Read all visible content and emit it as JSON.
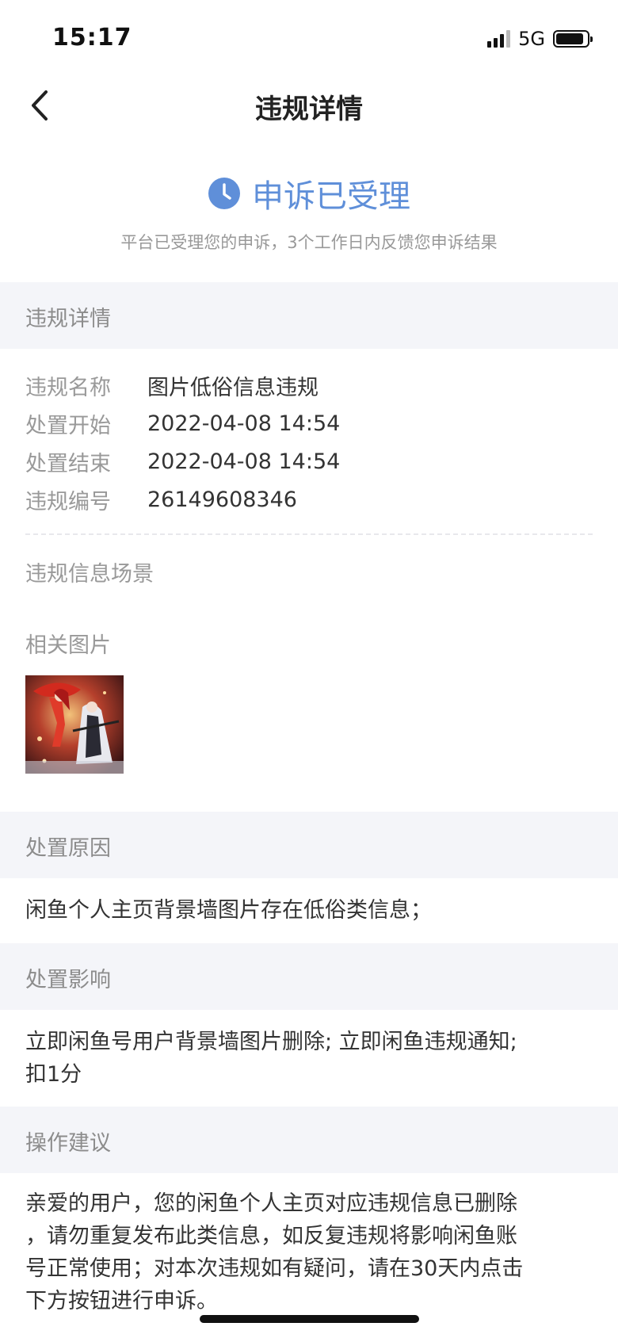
{
  "status_bar": {
    "time": "15:17",
    "network": "5G",
    "signal_icon": "signal-bars-icon",
    "battery_icon": "battery-icon"
  },
  "nav": {
    "title": "违规详情",
    "back_icon": "chevron-left-icon"
  },
  "appeal": {
    "icon": "clock-icon",
    "title": "申诉已受理",
    "description": "平台已受理您的申诉，3个工作日内反馈您申诉结果",
    "accent_color": "#5f8fd9"
  },
  "details_section": {
    "header": "违规详情",
    "rows": [
      {
        "label": "违规名称",
        "value": "图片低俗信息违规"
      },
      {
        "label": "处置开始",
        "value": "2022-04-08 14:54"
      },
      {
        "label": "处置结束",
        "value": "2022-04-08 14:54"
      },
      {
        "label": "违规编号",
        "value": "26149608346"
      }
    ],
    "scene_label": "违规信息场景",
    "images_label": "相关图片"
  },
  "reason_section": {
    "header": "处置原因",
    "text": "闲鱼个人主页背景墙图片存在低俗类信息；"
  },
  "impact_section": {
    "header": "处置影响",
    "line1": "立即闲鱼号用户背景墙图片删除; 立即闲鱼违规通知;",
    "line2": "扣1分"
  },
  "advice_section": {
    "header": "操作建议",
    "line1": "亲爱的用户，您的闲鱼个人主页对应违规信息已删除",
    "line2": "，请勿重复发布此类信息，如反复违规将影响闲鱼账",
    "line3": "号正常使用；对本次违规如有疑问，请在30天内点击",
    "line4": "下方按钮进行申诉。"
  },
  "colors": {
    "section_bg": "#f4f5f9",
    "label_gray": "#999999",
    "text_dark": "#333333"
  }
}
